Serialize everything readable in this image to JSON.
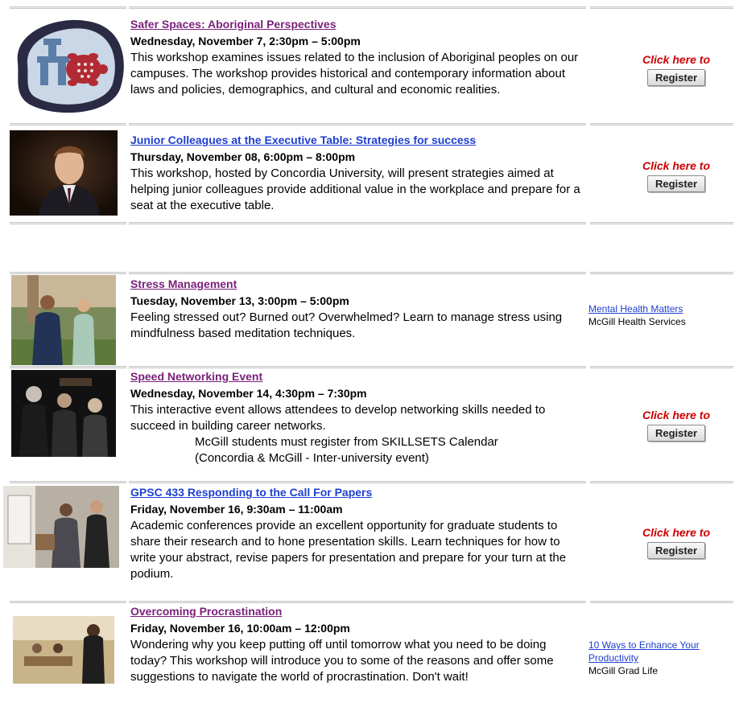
{
  "workshops": [
    {
      "title": "Safer Spaces: Aboriginal Perspectives",
      "date": "Wednesday, November 7, 2:30pm – 5:00pm",
      "description": "This workshop examines issues related to the inclusion of Aboriginal peoples on our campuses. The workshop provides historical and contemporary information about laws and policies, demographics, and cultural and economic realities.",
      "cta": "Click here to",
      "button": "Register",
      "image_icon": "inukshuk-turtle-logo-icon"
    },
    {
      "title": "Junior Colleagues at the Executive Table: Strategies for success",
      "date": "Thursday, November 08, 6:00pm – 8:00pm",
      "description": "This workshop, hosted by Concordia University, will present strategies aimed at helping junior colleagues provide additional value in the workplace and prepare for a seat at the executive table.",
      "cta": "Click here to",
      "button": "Register",
      "image_icon": "portrait-photo-icon"
    },
    {
      "title": "Stress Management",
      "date": "Tuesday, November 13, 3:00pm – 5:00pm",
      "description": "Feeling stressed out? Burned out? Overwhelmed? Learn to manage stress using mindfulness based meditation techniques.",
      "side_link": "Mental Health Matters",
      "side_text": "McGill Health Services",
      "image_icon": "conversation-photo-icon"
    },
    {
      "title": "Speed Networking Event",
      "date": "Wednesday, November 14, 4:30pm – 7:30pm",
      "description": "This interactive event allows attendees to develop networking skills needed to succeed in building career networks.",
      "note1": "McGill students must register from SKILLSETS Calendar",
      "note2": "(Concordia & McGill - Inter-university event)",
      "cta": "Click here to",
      "button": "Register",
      "image_icon": "networking-photo-icon"
    },
    {
      "title": "GPSC 433 Responding to the Call For Papers",
      "date": "Friday, November 16, 9:30am – 11:00am",
      "description": "Academic conferences provide an excellent opportunity for graduate students to share their research and to hone presentation skills. Learn techniques for how to write your abstract, revise papers for presentation and prepare for your turn at the podium.",
      "cta": "Click here to",
      "button": "Register",
      "image_icon": "poster-session-photo-icon"
    },
    {
      "title": "Overcoming Procrastination",
      "date": "Friday, November 16, 10:00am – 12:00pm",
      "description": "Wondering why you keep putting off until tomorrow what you need to be doing today? This workshop will introduce you to some of the reasons and offer some suggestions to navigate the world of procrastination. Don't wait!",
      "side_link": "10 Ways to Enhance Your Productivity",
      "side_text": "McGill Grad Life",
      "image_icon": "study-hall-photo-icon"
    }
  ],
  "colors": {
    "visited_link": "#7a1f7a",
    "link": "#1f3fcf",
    "cta": "#cc0000"
  }
}
